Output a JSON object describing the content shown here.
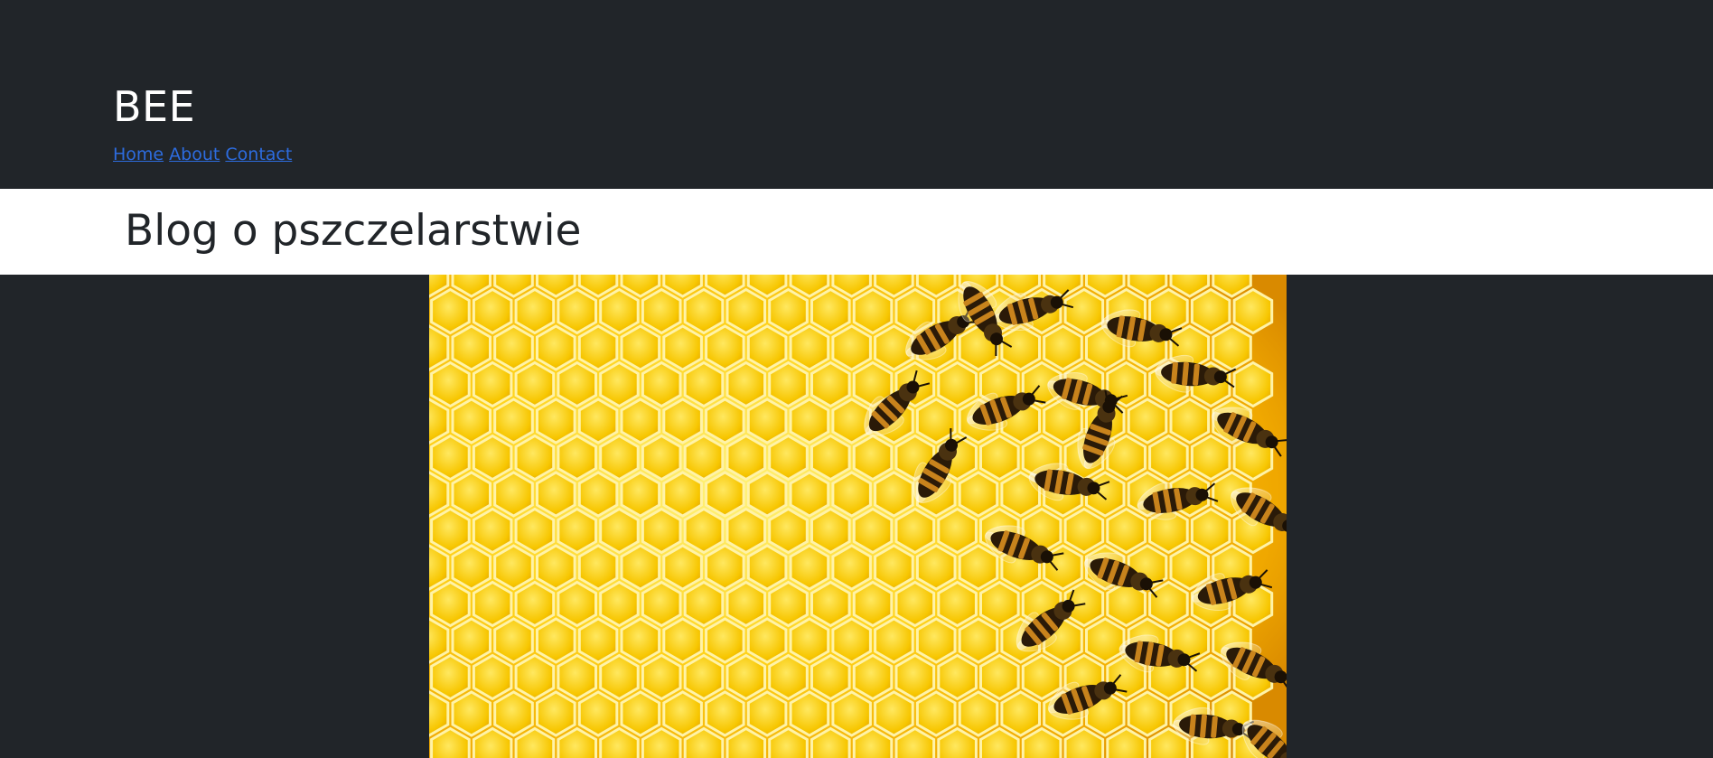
{
  "header": {
    "brand": "BEE",
    "nav": [
      {
        "label": "Home"
      },
      {
        "label": "About"
      },
      {
        "label": "Contact"
      }
    ]
  },
  "banner": {
    "title": "Blog o pszczelarstwie"
  },
  "hero": {
    "alt": "Bees on a golden honeycomb",
    "colors": {
      "honey_light": "#ffe14a",
      "honey_mid": "#f5c000",
      "honey_dark": "#d98a00",
      "wax_edge": "#fff3a8",
      "bee_body": "#2a1a08",
      "bee_stripe": "#c8831c"
    }
  },
  "colors": {
    "background": "#212529",
    "banner_bg": "#ffffff",
    "link": "#2d6cdf",
    "brand_text": "#ffffff"
  }
}
